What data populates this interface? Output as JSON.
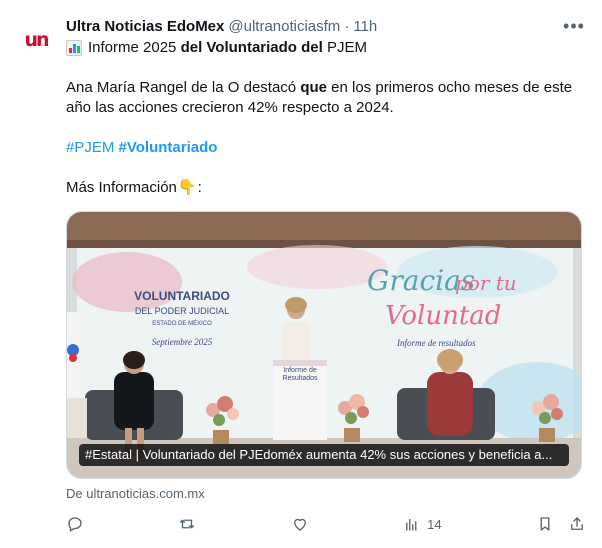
{
  "author": {
    "name": "Ultra Noticias EdoMex",
    "handle": "@ultranoticiasfm",
    "separator": "·",
    "time": "11h",
    "avatar_mark": "un"
  },
  "tweet": {
    "line1_a": "Informe 2025 ",
    "line1_b": "del Voluntariado del",
    "line1_c": " PJEM",
    "para_a": "Ana María Rangel de la O destacó ",
    "para_b": "que",
    "para_c": " en los primeros ocho meses de este año las acciones crecieron 42% respecto a 2024.",
    "hashtag1": "#PJEM",
    "hashtag2": "#Voluntariado",
    "more_info": "Más Información",
    "more_info_colon": ":",
    "point_emoji": "👇"
  },
  "media": {
    "banner_org_1": "VOLUNTARIADO",
    "banner_org_2": "DEL PODER JUDICIAL",
    "banner_org_3": "ESTADO DE MÉXICO",
    "banner_date": "Septiembre 2025",
    "banner_title_1": "Gracias",
    "banner_title_2": "por tu",
    "banner_title_3": "Voluntad",
    "banner_sub": "Informe de resultados",
    "podium_1": "Informe de",
    "podium_2": "Resultados",
    "caption": "#Estatal | Voluntariado del PJEdoméx aumenta 42% sus acciones y beneficia a..."
  },
  "link_source": "De ultranoticias.com.mx",
  "actions": {
    "views": "14"
  },
  "icons": {
    "more": "more-horizontal-icon",
    "chart": "bar-chart-icon",
    "reply": "reply-icon",
    "retweet": "retweet-icon",
    "like": "like-icon",
    "views": "views-icon",
    "bookmark": "bookmark-icon",
    "share": "share-icon"
  },
  "colors": {
    "link": "#1d9bf0",
    "muted": "#536471",
    "brand": "#c8102e"
  }
}
